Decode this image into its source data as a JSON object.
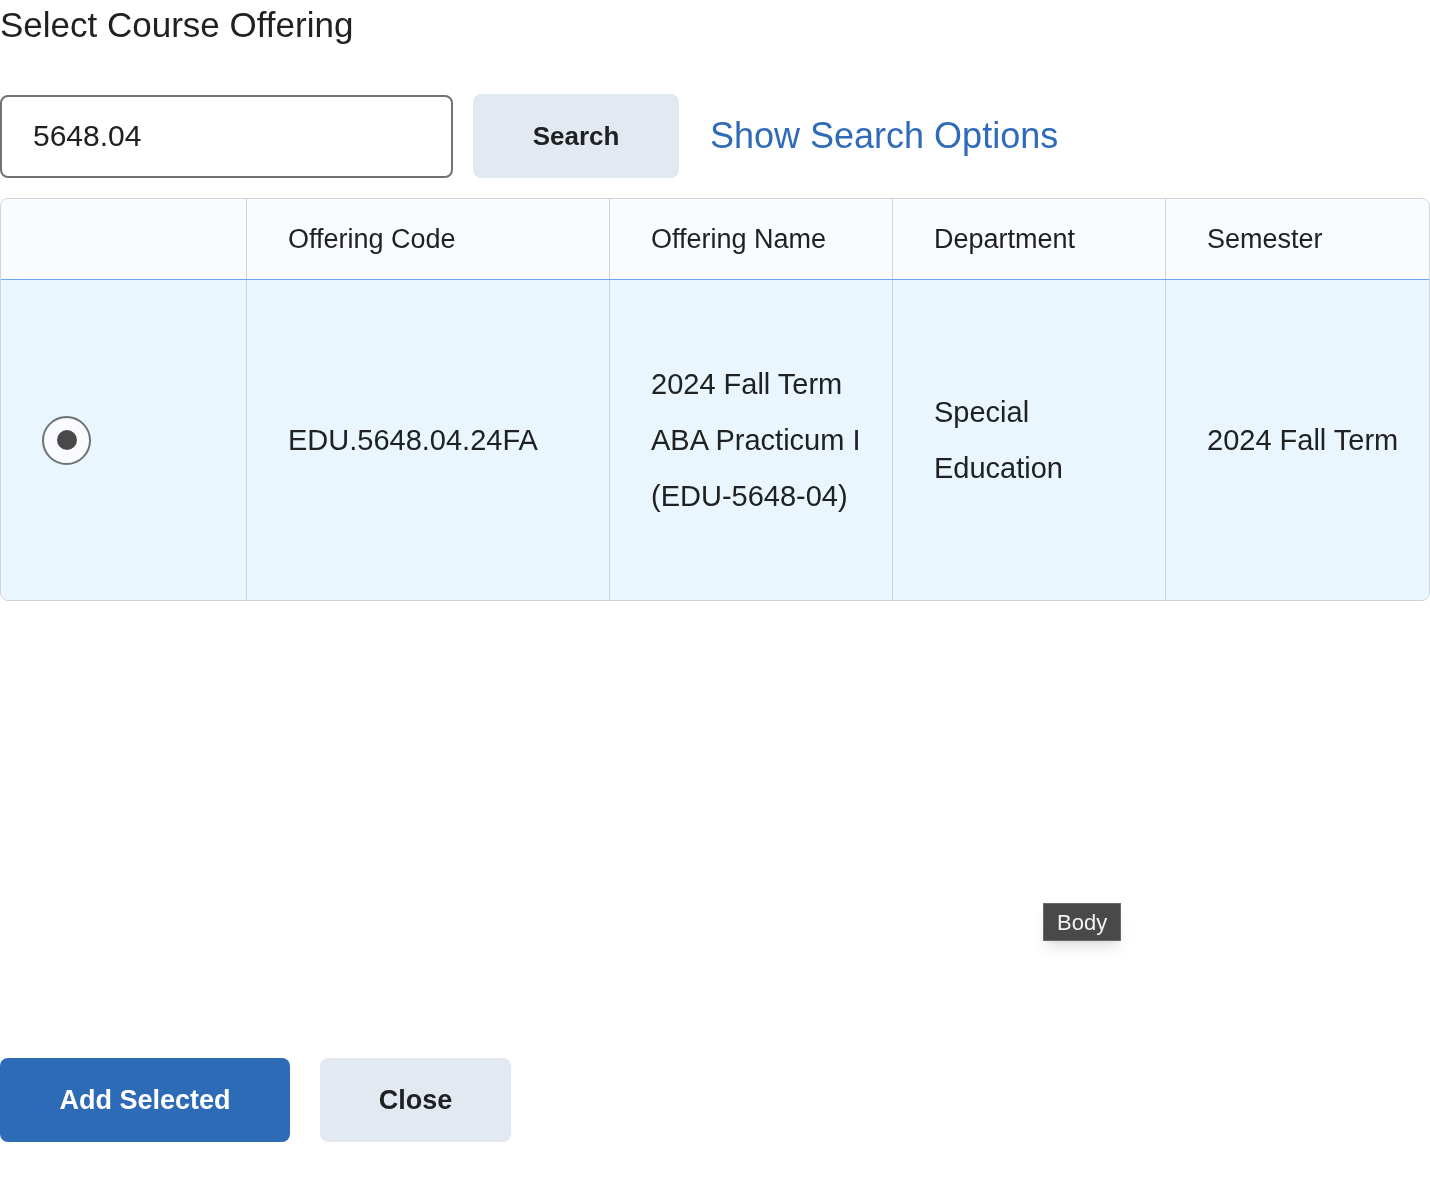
{
  "title": "Select Course Offering",
  "search": {
    "value": "5648.04",
    "button": "Search",
    "options_link": "Show Search Options"
  },
  "table": {
    "columns": [
      "Offering Code",
      "Offering Name",
      "Department",
      "Semester"
    ],
    "rows": [
      {
        "selected": true,
        "cells": [
          "EDU.5648.04.24FA",
          "2024 Fall Term ABA Practicum I (EDU-5648-04)",
          "Special Education",
          "2024 Fall Term"
        ]
      }
    ]
  },
  "tooltip": "Body",
  "buttons": [
    {
      "label": "Add Selected",
      "kind": "primary"
    },
    {
      "label": "Close",
      "kind": "secondary"
    }
  ]
}
